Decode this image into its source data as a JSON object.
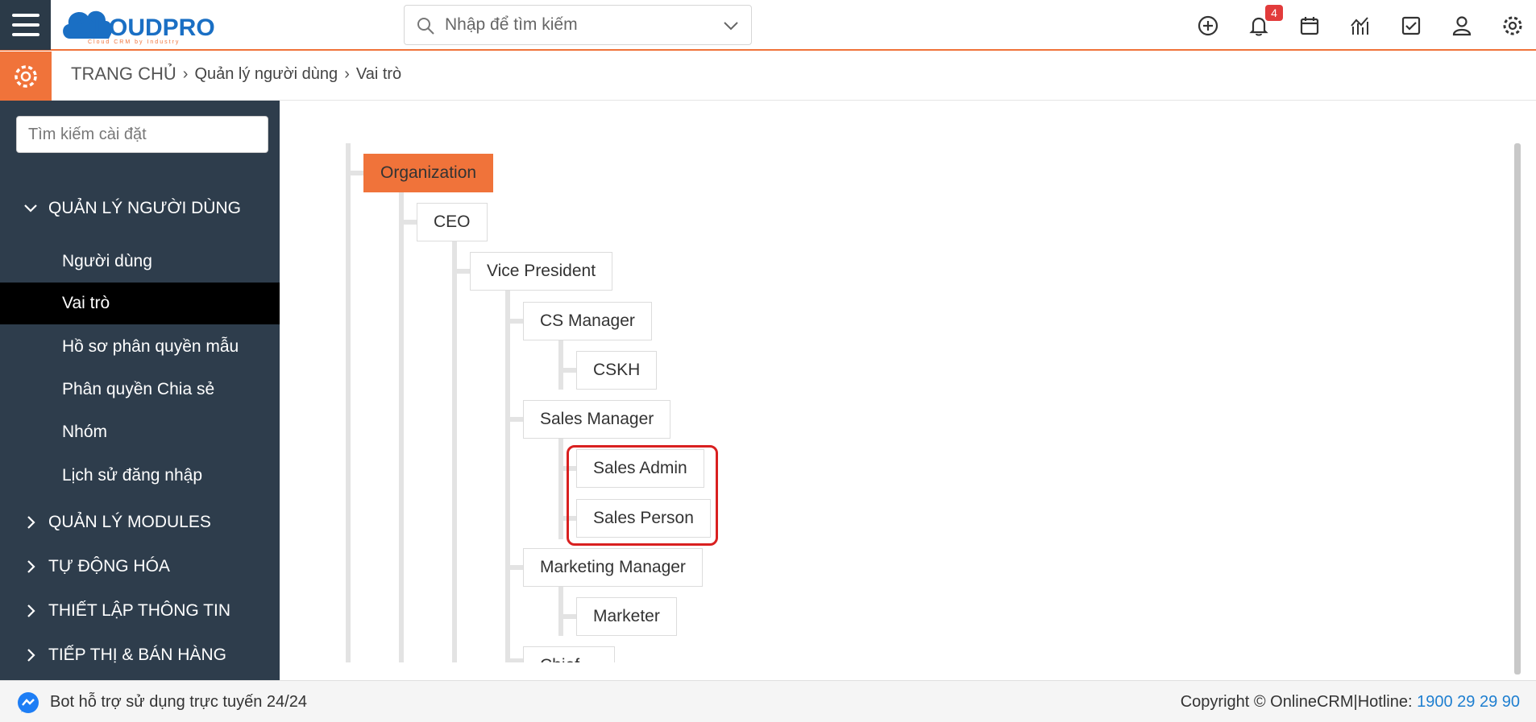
{
  "header": {
    "logo_text": "CLOUDPRO",
    "logo_tagline": "Cloud CRM by Industry",
    "search_placeholder": "Nhập để tìm kiếm",
    "notification_count": "4",
    "icons": [
      "plus-circle-icon",
      "bell-icon",
      "calendar-icon",
      "chart-icon",
      "checkbox-icon",
      "user-icon",
      "settings-icon"
    ]
  },
  "breadcrumb": {
    "home": "TRANG CHỦ",
    "items": [
      "Quản lý người dùng",
      "Vai trò"
    ]
  },
  "sidebar": {
    "search_placeholder": "Tìm kiếm cài đặt",
    "sections": [
      {
        "label": "QUẢN LÝ NGƯỜI DÙNG",
        "expanded": true,
        "items": [
          {
            "label": "Người dùng"
          },
          {
            "label": "Vai trò",
            "active": true
          },
          {
            "label": "Hồ sơ phân quyền mẫu"
          },
          {
            "label": "Phân quyền Chia sẻ"
          },
          {
            "label": "Nhóm"
          },
          {
            "label": "Lịch sử đăng nhập"
          }
        ]
      },
      {
        "label": "QUẢN LÝ MODULES",
        "expanded": false
      },
      {
        "label": "TỰ ĐỘNG HÓA",
        "expanded": false
      },
      {
        "label": "THIẾT LẬP THÔNG TIN",
        "expanded": false
      },
      {
        "label": "TIẾP THỊ & BÁN HÀNG",
        "expanded": false
      }
    ]
  },
  "roles_tree": {
    "nodes": [
      {
        "label": "Organization",
        "level": 0
      },
      {
        "label": "CEO",
        "level": 1
      },
      {
        "label": "Vice President",
        "level": 2
      },
      {
        "label": "CS Manager",
        "level": 3
      },
      {
        "label": "CSKH",
        "level": 4
      },
      {
        "label": "Sales Manager",
        "level": 3
      },
      {
        "label": "Sales Admin",
        "level": 4
      },
      {
        "label": "Sales Person",
        "level": 4
      },
      {
        "label": "Marketing Manager",
        "level": 3
      },
      {
        "label": "Marketer",
        "level": 4
      },
      {
        "label": "Chief ...",
        "level": 3
      }
    ]
  },
  "footer": {
    "bot_text": "Bot hỗ trợ sử dụng trực tuyến 24/24",
    "copyright": "Copyright © OnlineCRM|Hotline: ",
    "hotline": "1900 29 29 90"
  },
  "colors": {
    "accent": "#f0733a",
    "sidebar_bg": "#2e3d4c",
    "active_item_bg": "#000000",
    "highlight_border": "#d92020",
    "hotline": "#1f7fd0"
  }
}
